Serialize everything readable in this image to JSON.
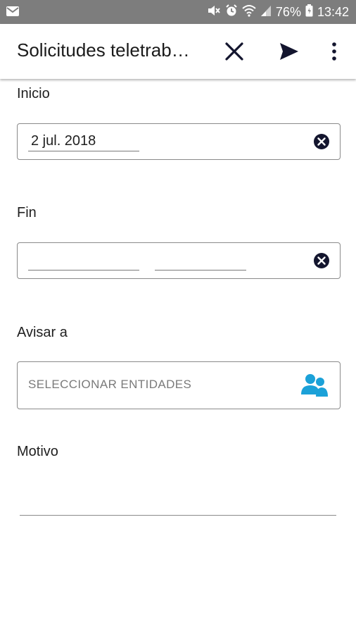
{
  "status_bar": {
    "battery_percent": "76%",
    "time": "13:42",
    "icons": [
      "mail-icon",
      "mute-icon",
      "alarm-icon",
      "wifi-icon",
      "signal-icon",
      "battery-icon"
    ]
  },
  "app_bar": {
    "title": "Solicitudes teletrab…",
    "icons": [
      "close-icon",
      "send-icon",
      "more-vert-icon"
    ]
  },
  "form": {
    "inicio": {
      "label": "Inicio",
      "date_value": "2 jul. 2018",
      "clear_icon": "clear-circle-icon"
    },
    "fin": {
      "label": "Fin",
      "date_value": "",
      "clear_icon": "clear-circle-icon"
    },
    "avisar": {
      "label": "Avisar a",
      "placeholder": "SELECCIONAR ENTIDADES",
      "icon": "people-icon"
    },
    "motivo": {
      "label": "Motivo",
      "value": ""
    }
  },
  "colors": {
    "status_bar_bg": "#7d7d7d",
    "icon_dark": "#13152e",
    "accent_people": "#1ba1d8",
    "border": "#8a8a8a",
    "placeholder": "#7a7a7a"
  }
}
